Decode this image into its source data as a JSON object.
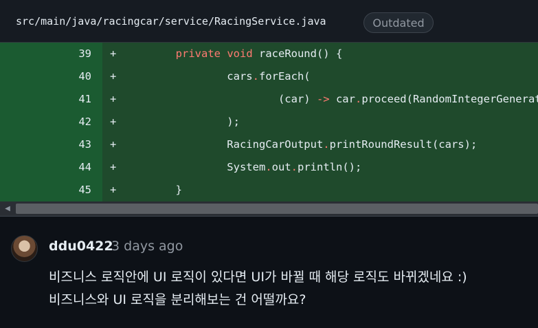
{
  "file": {
    "path": "src/main/java/racingcar/service/RacingService.java",
    "badge": "Outdated"
  },
  "code_lines": [
    {
      "num": "39",
      "marker": "+",
      "parts": [
        {
          "t": "        "
        },
        {
          "t": "private",
          "c": "kw"
        },
        {
          "t": " "
        },
        {
          "t": "void",
          "c": "kw"
        },
        {
          "t": " raceRound() {"
        }
      ]
    },
    {
      "num": "40",
      "marker": "+",
      "parts": [
        {
          "t": "                cars"
        },
        {
          "t": ".",
          "c": "op"
        },
        {
          "t": "forEach("
        }
      ]
    },
    {
      "num": "41",
      "marker": "+",
      "parts": [
        {
          "t": "                        (car) "
        },
        {
          "t": "->",
          "c": "op"
        },
        {
          "t": " car"
        },
        {
          "t": ".",
          "c": "op"
        },
        {
          "t": "proceed(RandomIntegerGenerator"
        }
      ]
    },
    {
      "num": "42",
      "marker": "+",
      "parts": [
        {
          "t": "                );"
        }
      ]
    },
    {
      "num": "43",
      "marker": "+",
      "parts": [
        {
          "t": "                RacingCarOutput"
        },
        {
          "t": ".",
          "c": "op"
        },
        {
          "t": "printRoundResult(cars);"
        }
      ]
    },
    {
      "num": "44",
      "marker": "+",
      "parts": [
        {
          "t": "                System"
        },
        {
          "t": ".",
          "c": "op"
        },
        {
          "t": "out"
        },
        {
          "t": ".",
          "c": "op"
        },
        {
          "t": "println();"
        }
      ]
    },
    {
      "num": "45",
      "marker": "+",
      "parts": [
        {
          "t": "        }"
        }
      ]
    }
  ],
  "comment": {
    "author": "ddu0422",
    "time": "3 days ago",
    "lines": [
      "비즈니스 로직안에 UI 로직이 있다면 UI가 바뀔 때 해당 로직도 바뀌겠네요 :)",
      "비즈니스와 UI 로직을 분리해보는 건 어떨까요?"
    ]
  },
  "colors": {
    "added_code_bg": "#1f4a2c",
    "added_gutter_bg": "#1b5b31",
    "keyword": "#ff7b72"
  }
}
